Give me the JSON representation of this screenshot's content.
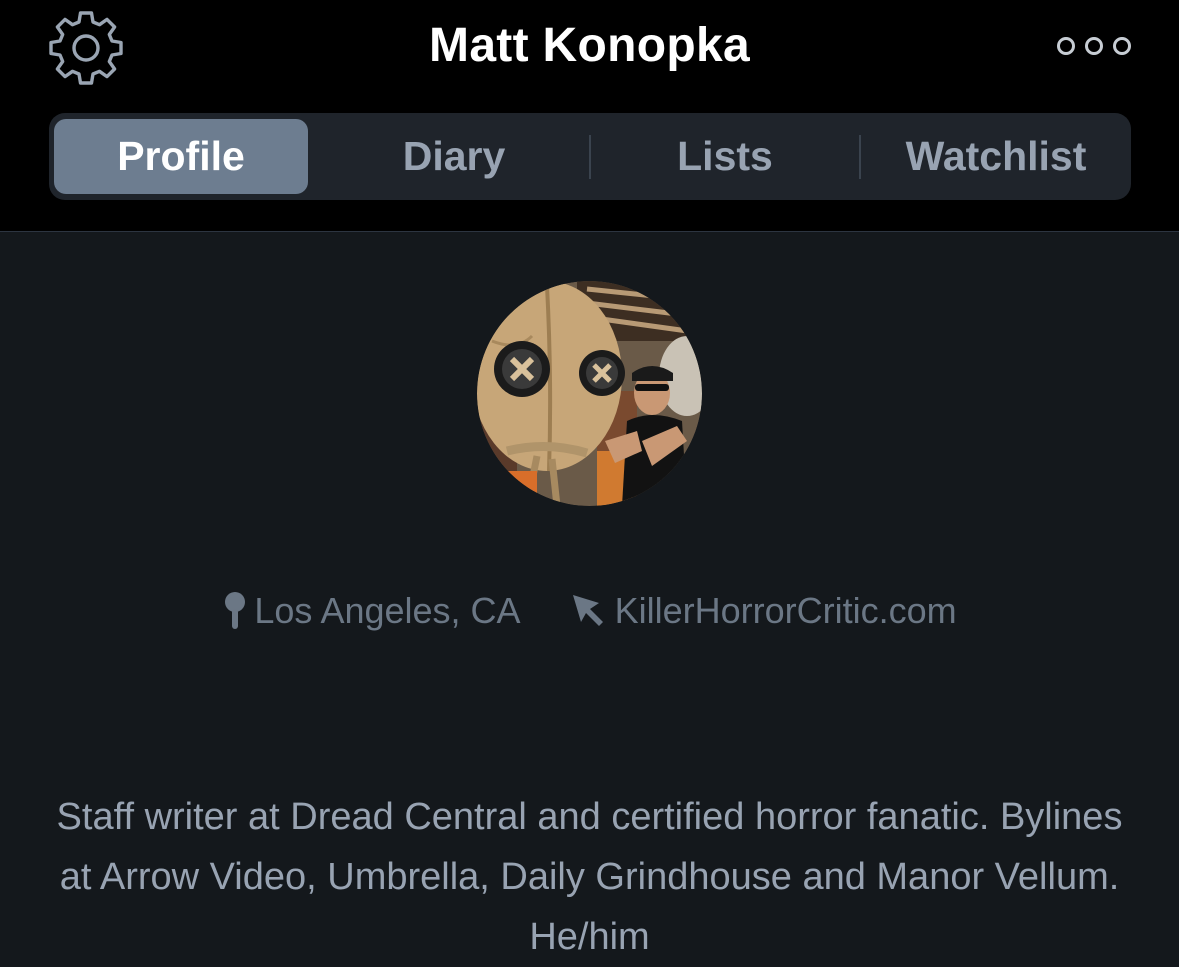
{
  "header": {
    "title": "Matt Konopka",
    "settings_icon": "gear-icon",
    "more_icon": "more-options-icon"
  },
  "tabs": [
    {
      "label": "Profile",
      "active": true
    },
    {
      "label": "Diary",
      "active": false
    },
    {
      "label": "Lists",
      "active": false
    },
    {
      "label": "Watchlist",
      "active": false
    }
  ],
  "profile": {
    "avatar": "profile-photo",
    "location": "Los Angeles, CA",
    "location_icon": "location-pin-icon",
    "website": "KillerHorrorCritic.com",
    "website_icon": "cursor-arrow-icon",
    "bio": "Staff writer at Dread Central and certified horror fanatic. Bylines at Arrow Video, Umbrella, Daily Grindhouse and Manor Vellum. He/him"
  },
  "colors": {
    "background": "#14181c",
    "header_background": "#000000",
    "active_tab": "#6d7d90",
    "muted_text": "#98a3b2"
  }
}
